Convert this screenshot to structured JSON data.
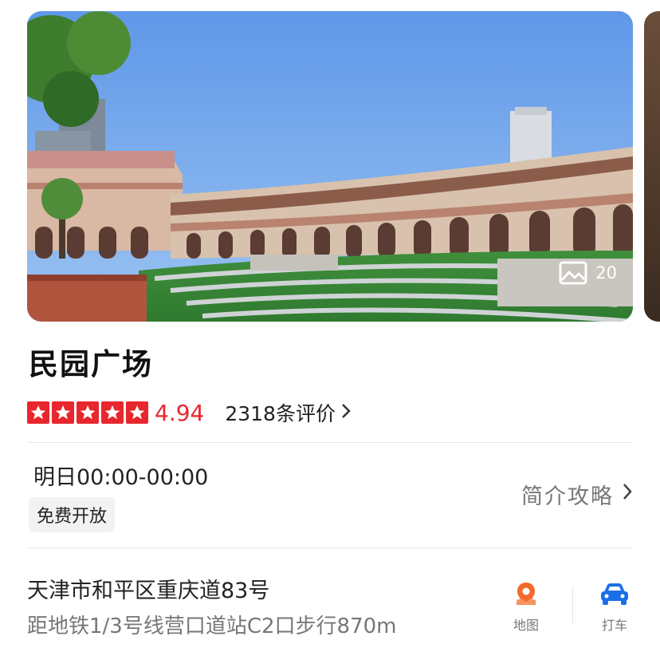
{
  "gallery": {
    "photo_count": "20",
    "icon": "image-icon"
  },
  "place": {
    "name": "民园广场",
    "rating": "4.94",
    "star_count": 5,
    "reviews": "2318条评价"
  },
  "hours": {
    "text": "明日00:00-00:00",
    "badge": "免费开放"
  },
  "guide": {
    "label": "简介攻略"
  },
  "location": {
    "address": "天津市和平区重庆道83号",
    "subway": "距地铁1/3号线营口道站C2口步行870m"
  },
  "actions": [
    {
      "label": "地图",
      "icon": "map-pin-icon",
      "color": "#f26a2c"
    },
    {
      "label": "打车",
      "icon": "car-icon",
      "color": "#1a6fe8"
    }
  ],
  "colors": {
    "rating_red": "#e8262d",
    "secondary_text": "#777777"
  }
}
